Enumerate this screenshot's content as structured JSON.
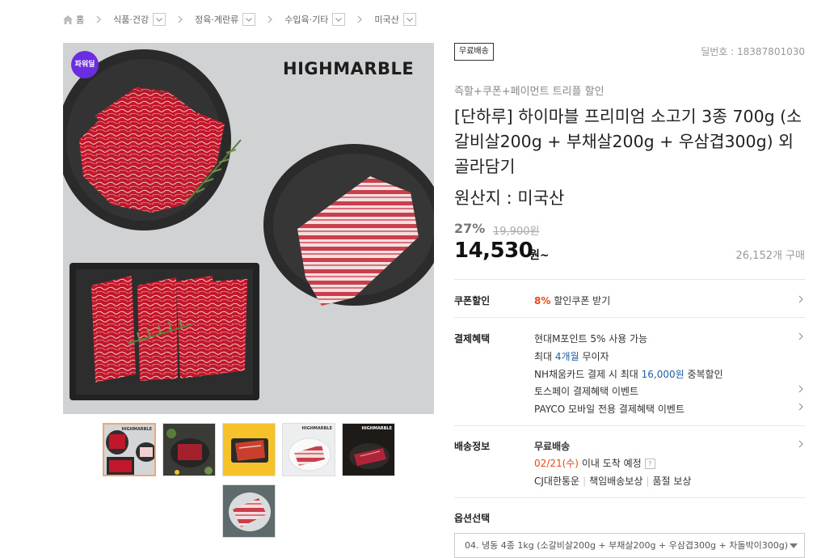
{
  "breadcrumb": {
    "items": [
      "홈",
      "식품·건강",
      "정육·계란류",
      "수입육·기타",
      "미국산"
    ]
  },
  "product": {
    "brand_overlay": "HIGHMARBLE",
    "power_badge": "파워딜",
    "free_shipping_badge": "무료배송",
    "deal_number": "딜번호 : 18387801030",
    "promo_text": "즉할+쿠폰+페이먼트 트리플 할인",
    "title": "[단하루] 하이마블 프리미엄 소고기 3종 700g (소갈비살200g + 부채살200g + 우삼겹300g) 외 골라담기",
    "origin": "원산지 : 미국산",
    "discount_rate": "27%",
    "original_price": "19,900원",
    "price": "14,530",
    "price_unit": "원~",
    "sold_count": "26,152개 구매"
  },
  "thumbnails": [
    {
      "label": "HIGHMARBLE",
      "active": true
    },
    {
      "label": "",
      "active": false
    },
    {
      "label": "",
      "active": false
    },
    {
      "label": "HIGHMARBLE",
      "active": false
    },
    {
      "label": "HIGHMARBLE",
      "active": false
    },
    {
      "label": "",
      "active": false
    }
  ],
  "coupon": {
    "label": "쿠폰할인",
    "percent": "8%",
    "text": "할인쿠폰 받기"
  },
  "payment": {
    "label": "결제혜택",
    "line1": "현대M포인트 5% 사용 가능",
    "line2_prefix": "최대 ",
    "line2_highlight": "4개월",
    "line2_suffix": " 무이자",
    "line3_prefix": "NH채움카드 결제 시 최대 ",
    "line3_highlight": "16,000원",
    "line3_suffix": " 중복할인",
    "line4": "토스페이 결제혜택 이벤트",
    "line5": "PAYCO 모바일 전용 결제혜택 이벤트"
  },
  "shipping": {
    "label": "배송정보",
    "line1": "무료배송",
    "date": "02/21(수)",
    "date_suffix": " 이내 도착 예정",
    "help": "?",
    "carrier": "CJ대한통운",
    "guarantee1": "책임배송보상",
    "guarantee2": "품절 보상"
  },
  "options": {
    "label": "옵션선택",
    "selected": "04. 냉동 4종 1kg (소갈비살200g + 부채살200g + 우삼겹300g + 차돌박이300g)"
  },
  "colors": {
    "accent_orange": "#e8491d",
    "link_blue": "#1f5ea8",
    "badge_purple": "#6a2de0"
  }
}
